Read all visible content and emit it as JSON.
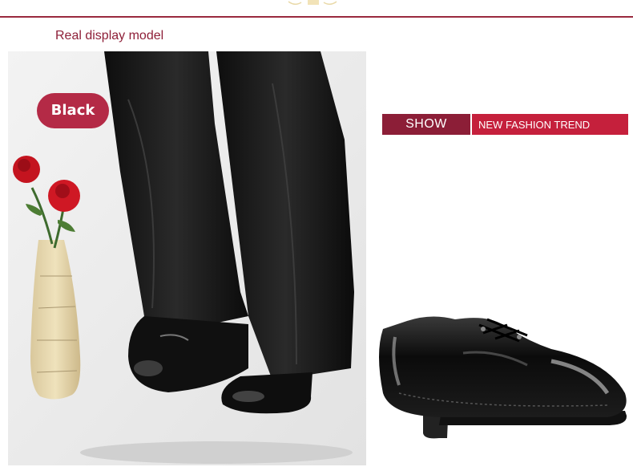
{
  "page": {
    "section_title": "Real display model",
    "color_badge": "Black",
    "show_label": "SHOW",
    "trend_label": "NEW FASHION TREND"
  },
  "colors": {
    "accent_dark": "#8c1e37",
    "accent_bright": "#c5203c",
    "badge": "#b42a46",
    "title_text": "#8e1f38"
  },
  "icons": {
    "ornament": "top-ornament-icon"
  }
}
